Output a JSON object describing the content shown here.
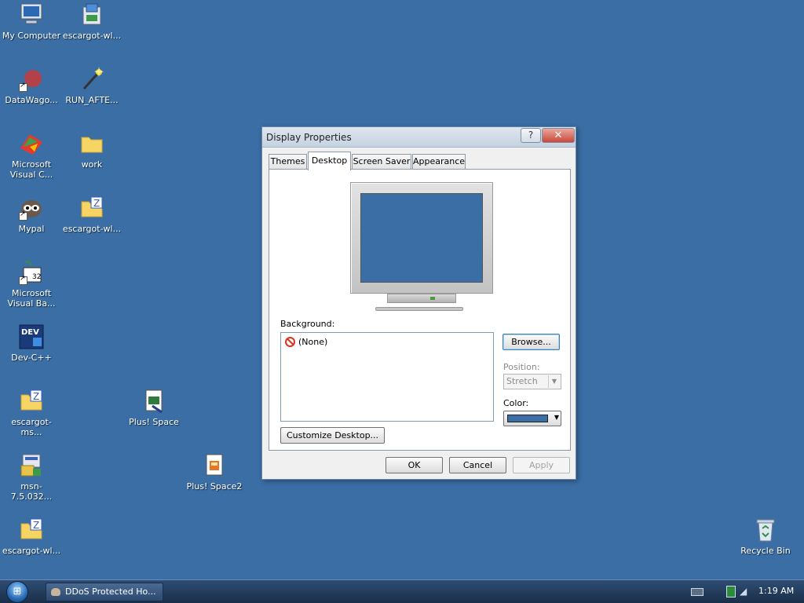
{
  "desktop": {
    "background_color": "#3a6ea5",
    "icons": [
      {
        "label": "My Computer",
        "icon": "computer-icon"
      },
      {
        "label": "escargot-wl...",
        "icon": "installer-icon"
      },
      {
        "label": "DataWago...",
        "icon": "datawagon-icon"
      },
      {
        "label": "RUN_AFTE...",
        "icon": "wand-icon"
      },
      {
        "label": "Microsoft Visual C...",
        "icon": "visual-c-icon"
      },
      {
        "label": "work",
        "icon": "folder-icon"
      },
      {
        "label": "Mypal",
        "icon": "mypal-icon"
      },
      {
        "label": "escargot-wl...",
        "icon": "zip-folder-icon"
      },
      {
        "label": "Microsoft Visual Ba...",
        "icon": "visual-basic-icon"
      },
      {
        "label": "Dev-C++",
        "icon": "devcpp-icon"
      },
      {
        "label": "escargot-ms...",
        "icon": "zip-folder-icon"
      },
      {
        "label": "Plus! Space",
        "icon": "plus-space-icon"
      },
      {
        "label": "msn-7.5.032...",
        "icon": "msn-installer-icon"
      },
      {
        "label": "Plus! Space2",
        "icon": "plus-space2-icon"
      },
      {
        "label": "escargot-wl...",
        "icon": "zip-folder-icon"
      },
      {
        "label": "Recycle Bin",
        "icon": "recycle-bin-icon"
      }
    ]
  },
  "dialog": {
    "title": "Display Properties",
    "help_button": "?",
    "close_button": "✕",
    "tabs": [
      {
        "label": "Themes"
      },
      {
        "label": "Desktop"
      },
      {
        "label": "Screen Saver"
      },
      {
        "label": "Appearance"
      }
    ],
    "active_tab": "Desktop",
    "background_label": "Background:",
    "background_items": [
      {
        "label": "(None)",
        "icon": "none-icon"
      }
    ],
    "browse_button": "Browse...",
    "position_label": "Position:",
    "position_value": "Stretch",
    "color_label": "Color:",
    "color_value": "#3a6ea5",
    "customize_button": "Customize Desktop...",
    "ok_button": "OK",
    "cancel_button": "Cancel",
    "apply_button": "Apply"
  },
  "taskbar": {
    "task_label": "DDoS Protected Ho...",
    "clock": "1:19 AM"
  }
}
